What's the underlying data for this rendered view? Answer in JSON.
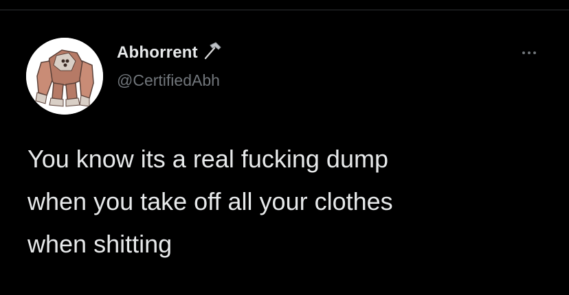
{
  "tweet": {
    "author": {
      "display_name": "Abhorrent",
      "handle": "@CertifiedAbh",
      "avatar_icon": "stone-golem-avatar",
      "name_emoji": "hammer-icon"
    },
    "more_icon": "more-options-icon",
    "text": "You know its a real fucking dump\nwhen you take off all your clothes\nwhen shitting"
  },
  "colors": {
    "background": "#000000",
    "primary_text": "#e7e9ea",
    "secondary_text": "#71767b",
    "divider": "#2f3336"
  }
}
